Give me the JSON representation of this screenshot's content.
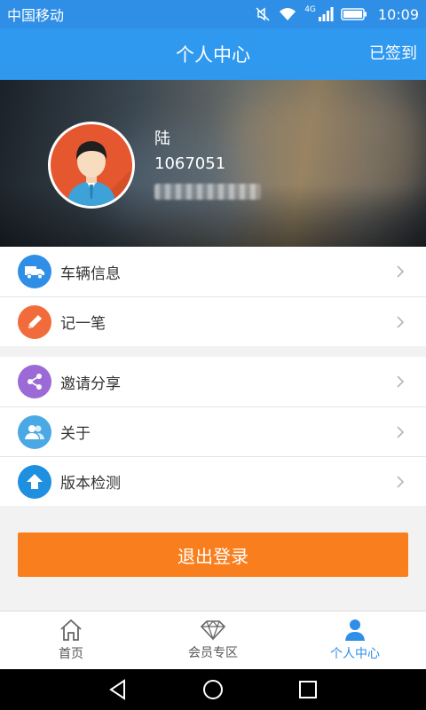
{
  "status_bar": {
    "carrier": "中国移动",
    "network": "4G",
    "time": "10:09",
    "icons": [
      "mute-icon",
      "wifi-icon",
      "signal-icon",
      "battery-icon"
    ]
  },
  "header": {
    "title": "个人中心",
    "checkin_label": "已签到"
  },
  "profile": {
    "name": "陆",
    "id": "1067051",
    "phone_masked": true
  },
  "menu_groups": [
    {
      "items": [
        {
          "label": "车辆信息",
          "icon": "truck-icon",
          "color": "#2f8fe6"
        },
        {
          "label": "记一笔",
          "icon": "pencil-icon",
          "color": "#f26c3b"
        }
      ]
    },
    {
      "items": [
        {
          "label": "邀请分享",
          "icon": "share-icon",
          "color": "#9b6ad6"
        },
        {
          "label": "关于",
          "icon": "people-icon",
          "color": "#4aa8e4"
        },
        {
          "label": "版本检测",
          "icon": "upload-arrow-icon",
          "color": "#1f8fe0"
        }
      ]
    }
  ],
  "logout_label": "退出登录",
  "tabs": [
    {
      "label": "首页",
      "icon": "home-icon",
      "active": false
    },
    {
      "label": "会员专区",
      "icon": "diamond-icon",
      "active": false
    },
    {
      "label": "个人中心",
      "icon": "person-icon",
      "active": true
    }
  ],
  "colors": {
    "primary": "#2f98ef",
    "logout": "#f97f1e",
    "active_tab": "#2f8fe6"
  }
}
